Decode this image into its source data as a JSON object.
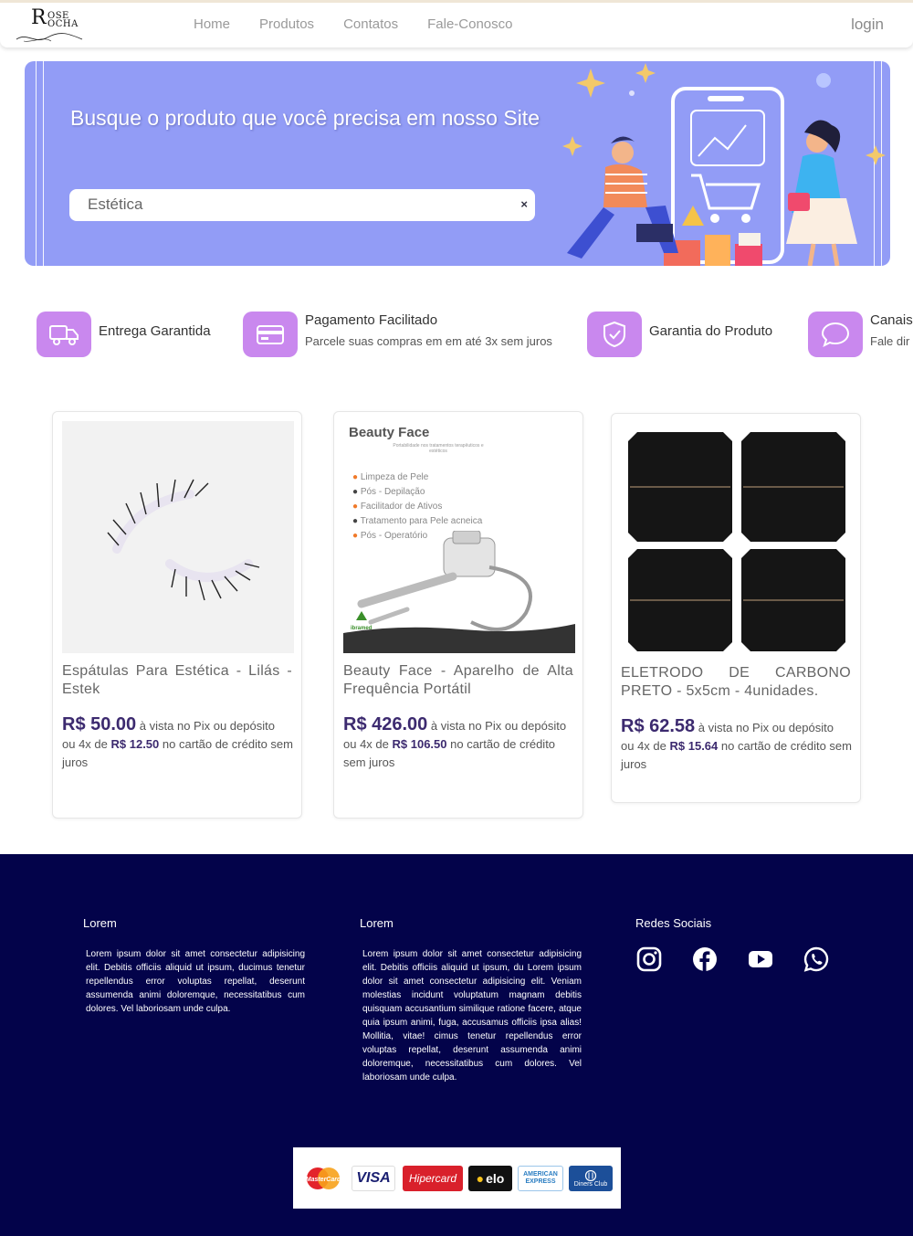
{
  "brand": {
    "logo_letters": "R",
    "logo_text": "OSE OCHA",
    "tagline": ""
  },
  "nav": {
    "items": [
      "Home",
      "Produtos",
      "Contatos",
      "Fale-Conosco"
    ],
    "login": "login"
  },
  "banner": {
    "title": "Busque o produto que você precisa em nosso Site",
    "search_value": "Estética",
    "clear_label": "×"
  },
  "features": [
    {
      "icon": "truck-icon",
      "title": "Entrega Garantida",
      "subtitle": ""
    },
    {
      "icon": "credit-card-icon",
      "title": "Pagamento Facilitado",
      "subtitle": "Parcele suas compras em em até 3x sem juros"
    },
    {
      "icon": "shield-check-icon",
      "title": "Garantia do Produto",
      "subtitle": ""
    },
    {
      "icon": "chat-bubble-icon",
      "title": "Canais",
      "subtitle": "Fale dir"
    }
  ],
  "products": [
    {
      "name": "Espátulas Para Estética - Lilás - Estek",
      "price": "R$ 50.00",
      "price_note": "à vista no Pix ou depósito",
      "inst_prefix": "ou 4x de",
      "inst_value": "R$ 12.50",
      "inst_suffix": "no cartão de crédito sem juros"
    },
    {
      "name": "Beauty Face - Aparelho de Alta Frequência Portátil",
      "price": "R$ 426.00",
      "price_note": "à vista no Pix ou depósito",
      "inst_prefix": "ou 4x de",
      "inst_value": "R$ 106.50",
      "inst_suffix": "no cartão de crédito sem juros",
      "image_text": {
        "title": "Beauty Face",
        "subtitle": "Portabilidade nos tratamentos terapêuticos e estéticos",
        "bullets": [
          "Limpeza de Pele",
          "Pós - Depilação",
          "Facilitador de Ativos",
          "Tratamento para Pele acneica",
          "Pós - Operatório"
        ],
        "brand": "ibramed"
      }
    },
    {
      "name": "ELETRODO DE CARBONO PRETO - 5x5cm - 4unidades.",
      "price": "R$ 62.58",
      "price_note": "à vista no Pix ou depósito",
      "inst_prefix": "ou 4x de",
      "inst_value": "R$ 15.64",
      "inst_suffix": "no cartão de crédito sem juros"
    }
  ],
  "footer": {
    "col1_title": "Lorem",
    "col1_text": "Lorem ipsum dolor sit amet consectetur adipisicing elit. Debitis officiis aliquid ut ipsum, ducimus tenetur repellendus error voluptas repellat, deserunt assumenda animi doloremque, necessitatibus cum dolores. Vel laboriosam unde culpa.",
    "col2_title": "Lorem",
    "col2_text": "Lorem ipsum dolor sit amet consectetur adipisicing elit. Debitis officiis aliquid ut ipsum, du Lorem ipsum dolor sit amet consectetur adipisicing elit. Veniam molestias incidunt voluptatum magnam debitis quisquam accusantium similique ratione facere, atque quia ipsum animi, fuga, accusamus officiis ipsa alias! Mollitia, vitae! cimus tenetur repellendus error voluptas repellat, deserunt assumenda animi doloremque, necessitatibus cum dolores. Vel laboriosam unde culpa.",
    "social_title": "Redes Sociais",
    "social": [
      "instagram-icon",
      "facebook-icon",
      "youtube-icon",
      "whatsapp-icon"
    ],
    "payments": [
      "MasterCard",
      "VISA",
      "Hipercard",
      "elo",
      "AMERICAN EXPRESS",
      "Diners Club"
    ]
  },
  "colors": {
    "banner": "#929cf6",
    "feature_icon": "#c988ee",
    "price": "#3c2a6f",
    "footer": "#03034a"
  }
}
